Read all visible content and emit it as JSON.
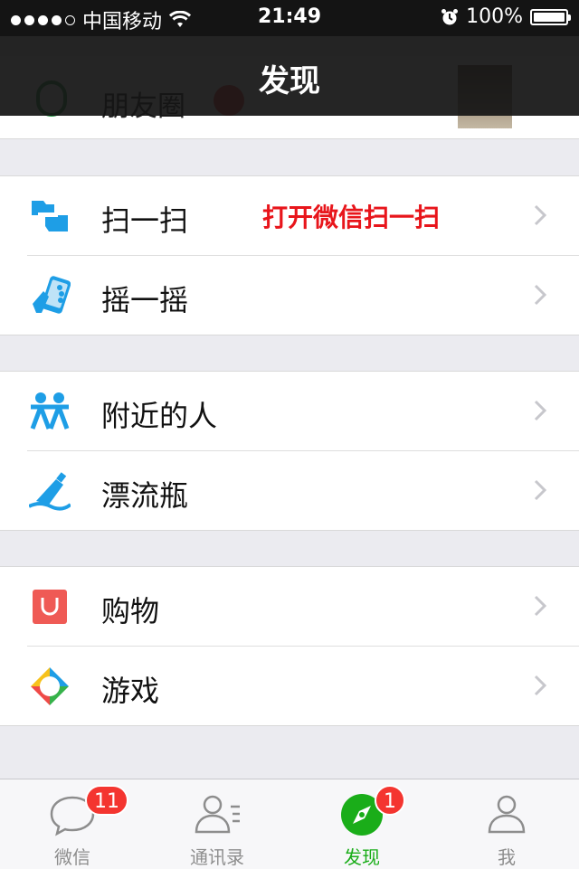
{
  "status_bar": {
    "signal_dots_filled": 4,
    "signal_dots_total": 5,
    "carrier": "中国移动",
    "time": "21:49",
    "battery_percent": "100%",
    "battery_level": 1.0
  },
  "nav": {
    "title": "发现"
  },
  "partial_row": {
    "label": "朋友圈"
  },
  "groups": [
    [
      {
        "label": "扫一扫",
        "icon": "scan-icon",
        "hint": "打开微信扫一扫"
      },
      {
        "label": "摇一摇",
        "icon": "shake-icon"
      }
    ],
    [
      {
        "label": "附近的人",
        "icon": "people-nearby-icon"
      },
      {
        "label": "漂流瓶",
        "icon": "drift-bottle-icon"
      }
    ],
    [
      {
        "label": "购物",
        "icon": "shopping-bag-icon"
      },
      {
        "label": "游戏",
        "icon": "games-icon"
      }
    ]
  ],
  "tabbar": [
    {
      "label": "微信",
      "icon": "chat-bubble-icon",
      "badge": "11"
    },
    {
      "label": "通讯录",
      "icon": "contacts-icon",
      "badge": null
    },
    {
      "label": "发现",
      "icon": "compass-icon",
      "badge": "1",
      "active": true
    },
    {
      "label": "我",
      "icon": "profile-icon",
      "badge": null
    }
  ],
  "colors": {
    "accent_green": "#1aad19",
    "badge_red": "#f43530",
    "hint_red": "#e8151b",
    "icon_blue": "#1e9ee6"
  }
}
